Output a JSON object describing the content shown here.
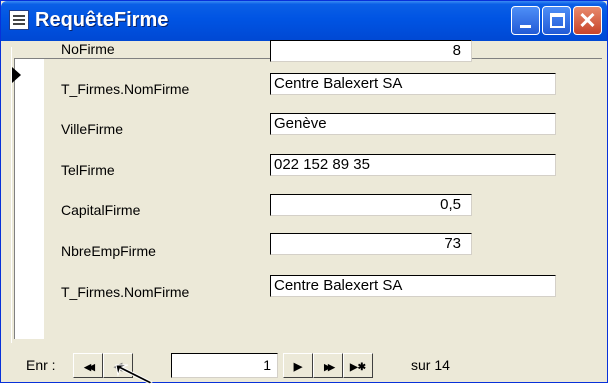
{
  "window": {
    "title": "RequêteFirme"
  },
  "fields": [
    {
      "label": "NoFirme",
      "value": "8",
      "align": "right"
    },
    {
      "label": "T_Firmes.NomFirme",
      "value": "Centre Balexert SA",
      "align": "left"
    },
    {
      "label": "VilleFirme",
      "value": "Genève",
      "align": "left"
    },
    {
      "label": "TelFirme",
      "value": "022 152 89 35",
      "align": "left"
    },
    {
      "label": "CapitalFirme",
      "value": "0,5",
      "align": "right"
    },
    {
      "label": "NbreEmpFirme",
      "value": "73",
      "align": "right"
    },
    {
      "label": "T_Firmes.NomFirme",
      "value": "Centre Balexert SA",
      "align": "left"
    }
  ],
  "navigation": {
    "label": "Enr :",
    "current_record": "1",
    "total_label": "sur 14",
    "first_glyph": "◀◀",
    "prev_glyph": "◀",
    "next_glyph": "▶",
    "last_glyph": "▶▶",
    "new_glyph": "▶✱"
  },
  "colors": {
    "titlebar": "#0054e3",
    "close_button": "#c7442a",
    "form_background": "#ece9d8"
  }
}
